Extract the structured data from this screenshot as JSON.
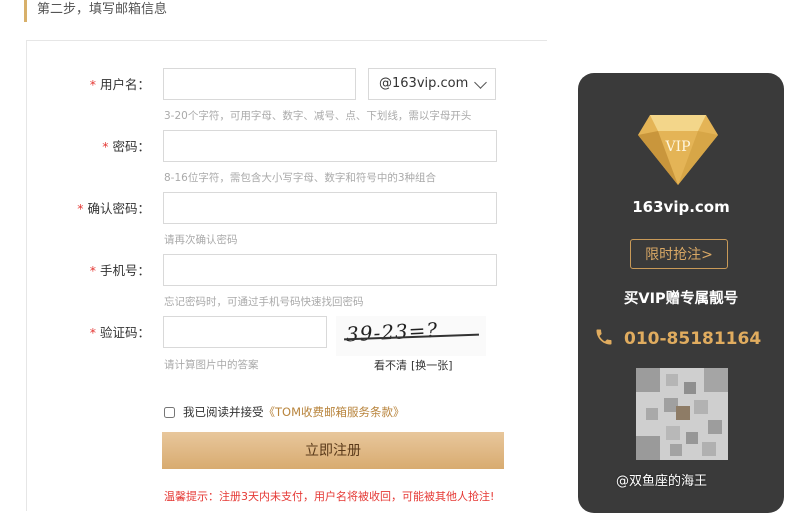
{
  "step": {
    "title": "第二步，填写邮箱信息"
  },
  "form": {
    "required_mark": "*",
    "username": {
      "label": "用户名：",
      "value": "",
      "domain": "@163vip.com",
      "hint": "3-20个字符，可用字母、数字、减号、点、下划线，需以字母开头"
    },
    "password": {
      "label": "密码：",
      "value": "",
      "hint": "8-16位字符，需包含大小写字母、数字和符号中的3种组合"
    },
    "confirm_password": {
      "label": "确认密码：",
      "value": "",
      "hint": "请再次确认密码"
    },
    "phone": {
      "label": "手机号：",
      "value": "",
      "hint": "忘记密码时，可通过手机号码快速找回密码"
    },
    "captcha": {
      "label": "验证码：",
      "value": "",
      "hint": "请计算图片中的答案",
      "image_text": "39-23=?",
      "unclear_label": "看不清",
      "refresh_label": "[换一张]"
    },
    "agreement": {
      "prefix": "我已阅读并接受",
      "terms_link": "《TOM收费邮箱服务条款》",
      "checked": false
    },
    "submit_label": "立即注册",
    "warning": "温馨提示：注册3天内未支付，用户名将被收回，可能被其他人抢注!"
  },
  "sidebar": {
    "gem_text": "VIP",
    "domain": "163vip.com",
    "promo_button": "限时抢注>",
    "slogan": "买VIP赠专属靓号",
    "phone": "010-85181164",
    "qr_icon": "qr-code-icon"
  },
  "watermark": "@双鱼座的海王",
  "colors": {
    "accent_gold": "#d9a865",
    "submit_bg": "#dfb77f",
    "sidebar_bg": "#3a3a3a",
    "required": "#e53935"
  }
}
